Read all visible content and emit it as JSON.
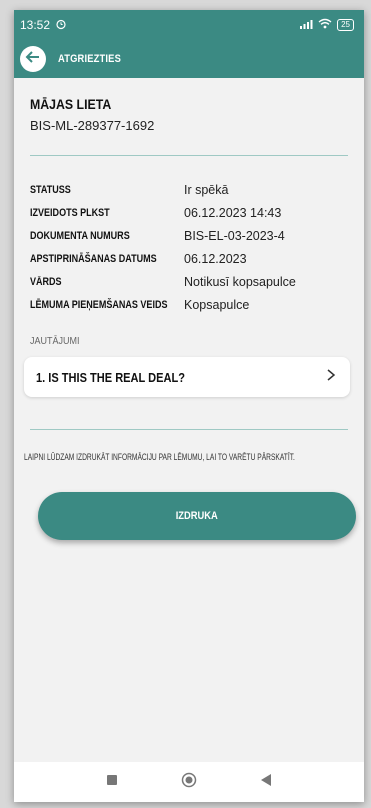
{
  "status_bar": {
    "time": "13:52",
    "battery": "25"
  },
  "app_bar": {
    "back_label": "ATGRIEZTIES"
  },
  "case": {
    "title": "MĀJAS LIETA",
    "id": "BIS-ML-289377-1692"
  },
  "details": [
    {
      "label": "STATUSS",
      "value": "Ir spēkā"
    },
    {
      "label": "IZVEIDOTS PLKST",
      "value": "06.12.2023 14:43"
    },
    {
      "label": "DOKUMENTA NUMURS",
      "value": "BIS-EL-03-2023-4"
    },
    {
      "label": "APSTIPRINĀŠANAS DATUMS",
      "value": "06.12.2023"
    },
    {
      "label": "VĀRDS",
      "value": "Notikusī kopsapulce"
    },
    {
      "label": "LĒMUMA PIEŅEMŠANAS VEIDS",
      "value": "Kopsapulce"
    }
  ],
  "questions": {
    "label": "JAUTĀJUMI",
    "items": [
      {
        "text": "1. IS THIS THE REAL DEAL?"
      }
    ]
  },
  "info_text": "LAIPNI LŪDZAM IZDRUKĀT INFORMĀCIJU PAR LĒMUMU, LAI TO VARĒTU PĀRSKATĪT.",
  "print_button": {
    "label": "IZDRUKA"
  },
  "colors": {
    "accent": "#3b8a83",
    "background": "#f2f2f2"
  },
  "icons": {
    "back": "arrow-left-icon",
    "alarm": "alarm-icon",
    "signal": "signal-icon",
    "wifi": "wifi-icon",
    "battery": "battery-icon",
    "chevron": "chevron-right-icon",
    "nav_recent": "square-icon",
    "nav_home": "circle-icon",
    "nav_back": "triangle-back-icon"
  }
}
